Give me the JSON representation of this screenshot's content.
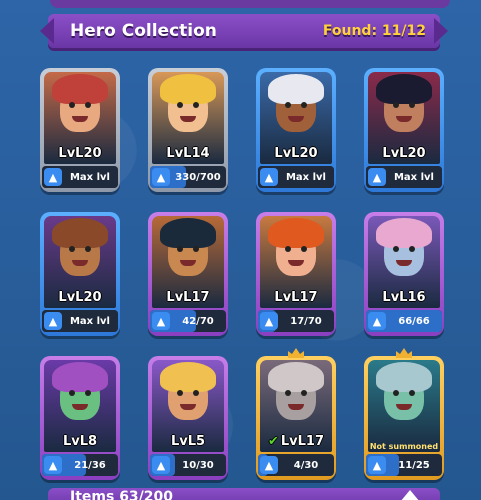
{
  "banner": {
    "title": "Hero Collection",
    "found": "Found: 11/12"
  },
  "bottom": {
    "label": "Items 63/200"
  },
  "heroes": [
    {
      "level": "LvL20",
      "progress": "Max lvl",
      "frame": "grey",
      "skin": "#e8a880",
      "hair": "#c0403a",
      "bg": "#c46a48",
      "pct": 100,
      "max": true
    },
    {
      "level": "LvL14",
      "progress": "330/700",
      "frame": "grey",
      "skin": "#f2c090",
      "hair": "#f0c040",
      "bg": "#d89858",
      "pct": 47,
      "max": false
    },
    {
      "level": "LvL20",
      "progress": "Max lvl",
      "frame": "blue",
      "skin": "#a0603a",
      "hair": "#e8e8f0",
      "bg": "#3a6aa8",
      "pct": 100,
      "max": true
    },
    {
      "level": "LvL20",
      "progress": "Max lvl",
      "frame": "blue",
      "skin": "#c08060",
      "hair": "#1a1a30",
      "bg": "#8a2a4a",
      "pct": 100,
      "max": true
    },
    {
      "level": "LvL20",
      "progress": "Max lvl",
      "frame": "blue",
      "skin": "#b87848",
      "hair": "#8a4a2a",
      "bg": "#6a3a8a",
      "pct": 100,
      "max": true
    },
    {
      "level": "LvL17",
      "progress": "42/70",
      "frame": "purple",
      "skin": "#c88850",
      "hair": "#1a2a3a",
      "bg": "#b86a38",
      "pct": 60,
      "max": false
    },
    {
      "level": "LvL17",
      "progress": "17/70",
      "frame": "purple",
      "skin": "#f0b090",
      "hair": "#e05a20",
      "bg": "#c87a40",
      "pct": 24,
      "max": false
    },
    {
      "level": "LvL16",
      "progress": "66/66",
      "frame": "purple",
      "skin": "#a8c0e0",
      "hair": "#e8a8d0",
      "bg": "#7a58b8",
      "pct": 100,
      "max": false
    },
    {
      "level": "LvL8",
      "progress": "21/36",
      "frame": "purple",
      "skin": "#6ac080",
      "hair": "#a050c0",
      "bg": "#6a3aa8",
      "pct": 58,
      "max": false
    },
    {
      "level": "LvL5",
      "progress": "10/30",
      "frame": "purple",
      "skin": "#e0a070",
      "hair": "#f0c050",
      "bg": "#8a58c8",
      "pct": 33,
      "max": false
    },
    {
      "level": "LvL17",
      "progress": "4/30",
      "frame": "gold",
      "skin": "#a8a0a0",
      "hair": "#d0c8c8",
      "bg": "#7a6a7a",
      "pct": 13,
      "max": false,
      "check": "✔"
    },
    {
      "level": "",
      "progress": "11/25",
      "frame": "gold",
      "skin": "#78c0a8",
      "hair": "#a8c8d0",
      "bg": "#2a7a8a",
      "pct": 44,
      "max": false,
      "note": "Not summoned"
    }
  ]
}
